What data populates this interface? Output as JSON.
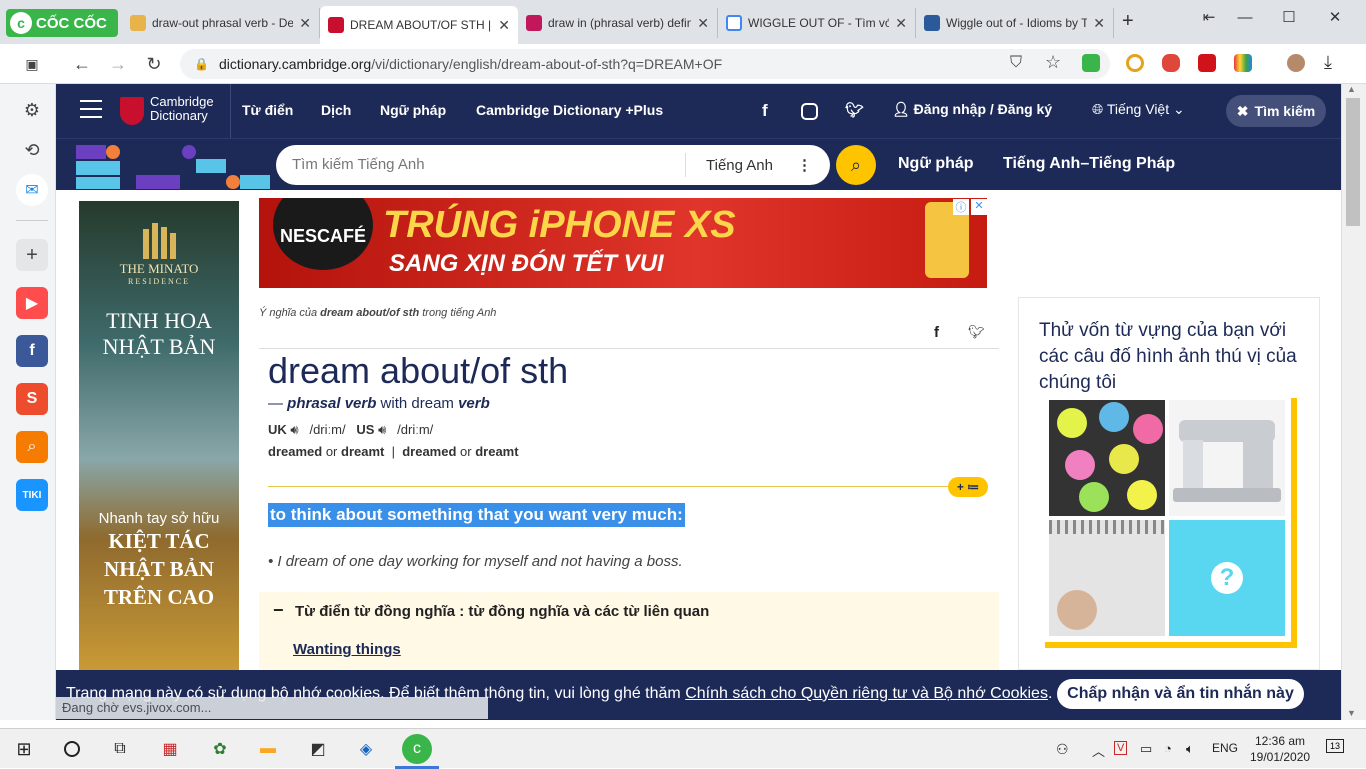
{
  "browser": {
    "brand": "CỐC CỐC",
    "tabs": [
      {
        "title": "draw-out phrasal verb - De",
        "active": false
      },
      {
        "title": "DREAM ABOUT/OF STH | E",
        "active": true
      },
      {
        "title": "draw in (phrasal verb) defin",
        "active": false
      },
      {
        "title": "WIGGLE OUT OF - Tìm với C",
        "active": false
      },
      {
        "title": "Wiggle out of - Idioms by T",
        "active": false
      }
    ],
    "new_tab": "+",
    "url_domain": "dictionary.cambridge.org",
    "url_path": "/vi/dictionary/english/dream-about-of-sth?q=DREAM+OF"
  },
  "site": {
    "logo_line1": "Cambridge",
    "logo_line2": "Dictionary",
    "nav": [
      "Từ điển",
      "Dịch",
      "Ngữ pháp",
      "Cambridge Dictionary +Plus"
    ],
    "login": "Đăng nhập / Đăng ký",
    "language": "Tiếng Việt",
    "search_toggle": "Tìm kiếm",
    "search_placeholder": "Tìm kiếm Tiếng Anh",
    "search_lang": "Tiếng Anh",
    "sub_links": [
      "Ngữ pháp",
      "Tiếng Anh–Tiếng Pháp"
    ]
  },
  "ads": {
    "left_brand": "THE MINATO",
    "left_brand_sub": "RESIDENCE",
    "left_title": "TINH HOA NHẬT BẢN",
    "left_bottom1": "Nhanh tay sở hữu",
    "left_bottom2": "KIỆT TÁC",
    "left_bottom3": "NHẬT BẢN",
    "left_bottom4": "TRÊN CAO",
    "top_brand": "NESCAFÉ",
    "top_line1": "TRÚNG iPHONE XS",
    "top_line2": "SANG XỊN ĐÓN TẾT VUI"
  },
  "entry": {
    "crumb_prefix": "Ý nghĩa của ",
    "crumb_word": "dream about/of sth",
    "crumb_suffix": " trong tiếng Anh",
    "headword": "dream about/of sth",
    "pos_dash": "— ",
    "pos": "phrasal verb",
    "pos_with": " with dream ",
    "pos2": "verb",
    "uk": "UK",
    "uk_ipa": "/driːm/",
    "us": "US",
    "us_ipa": "/driːm/",
    "form1": "dreamed",
    "or1": " or ",
    "form2": "dreamt",
    "sep": "|",
    "form3": "dreamed",
    "or2": " or ",
    "form4": "dreamt",
    "definition": "to think about something that you want very much:",
    "example": "I dream of one day working for myself and not having a boss.",
    "thesaurus_title": "Từ điển từ đồng nghĩa : từ đồng nghĩa và các từ liên quan",
    "thesaurus_link": "Wanting things"
  },
  "quiz": {
    "prompt": "Thử vốn từ vựng của bạn với các câu đố hình ảnh thú vị của chúng tôi"
  },
  "cookie": {
    "text": "Trang mạng này có sử dụng bộ nhớ cookies. Để biết thêm thông tin, vui lòng ghé thăm ",
    "link": "Chính sách cho Quyền riêng tư và Bộ nhớ Cookies",
    "end": ".",
    "button": "Chấp nhận và ẩn tin nhắn này"
  },
  "status_text": "Đang chờ evs.jivox.com...",
  "taskbar": {
    "lang": "ENG",
    "time": "12:36 am",
    "date": "19/01/2020",
    "notif": "13"
  }
}
